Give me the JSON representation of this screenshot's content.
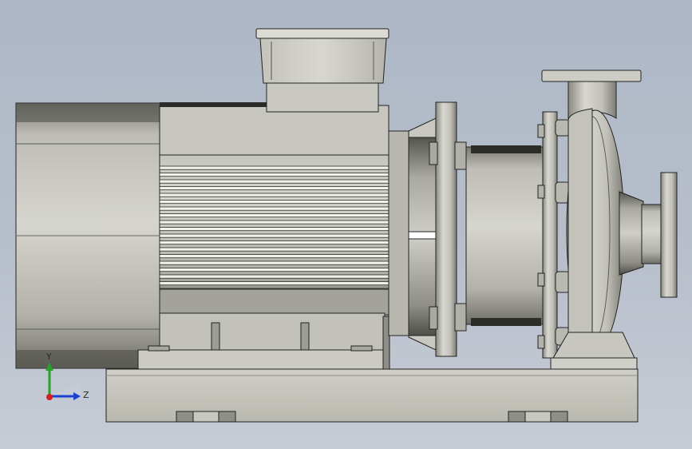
{
  "viewport": {
    "background_top": "#aeb7c6",
    "background_bottom": "#c6ccd5"
  },
  "model": {
    "name": "centrifugal-pump-assembly",
    "metal_light": "#d9d9d2",
    "metal_mid": "#bdbdb4",
    "metal_dark": "#6d6d66",
    "edge": "#1e1e1e"
  },
  "triad": {
    "y_label": "Y",
    "z_label": "Z",
    "y_color": "#2aa02a",
    "z_color": "#1f3fd0",
    "x_color": "#d42020"
  }
}
